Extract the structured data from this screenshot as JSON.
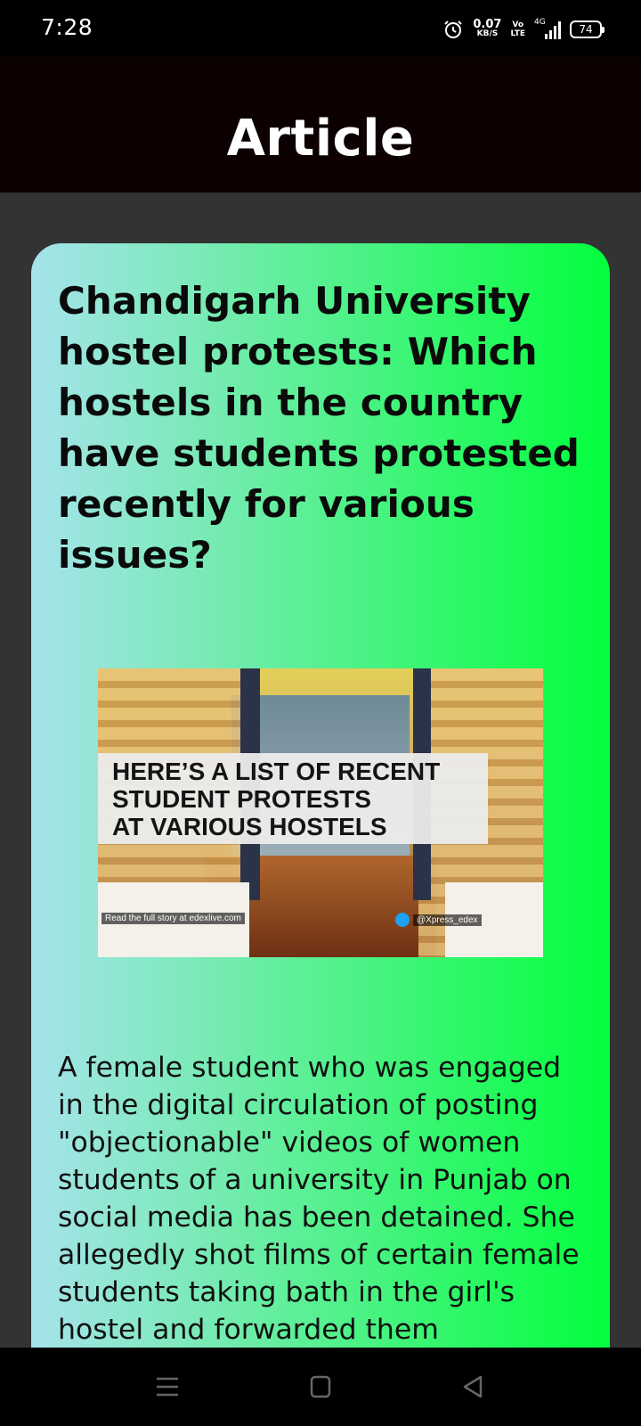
{
  "status_bar": {
    "time": "7:28",
    "net_speed_value": "0.07",
    "net_speed_unit": "KB/S",
    "volte_top": "Vo",
    "volte_bottom": "LTE",
    "network_type": "4G",
    "battery": "74"
  },
  "app_bar": {
    "title": "Article"
  },
  "article": {
    "headline": "Chandigarh University hostel protests: Which hostels in the country have students protested recently for various issues?",
    "image": {
      "banner_lines": [
        "HERE’S A LIST OF RECENT",
        "STUDENT PROTESTS",
        "AT VARIOUS HOSTELS"
      ],
      "footer_left": "Read the full story at edexlive.com",
      "footer_right": "@Xpress_edex"
    },
    "body": "A female student who was engaged in the digital circulation of posting \"objectionable\" videos of women students of a university in Punjab on social media has been detained. She allegedly shot films of certain female students taking bath in the girl's hostel and forwarded them"
  },
  "colors": {
    "card_gradient_start": "#a6e3ec",
    "card_gradient_end": "#02ff3d",
    "app_bar_bg": "#0c0000",
    "page_bg": "#333333"
  },
  "nav_bar": {
    "icons": [
      "menu-icon",
      "home-square-icon",
      "back-triangle-icon"
    ]
  }
}
